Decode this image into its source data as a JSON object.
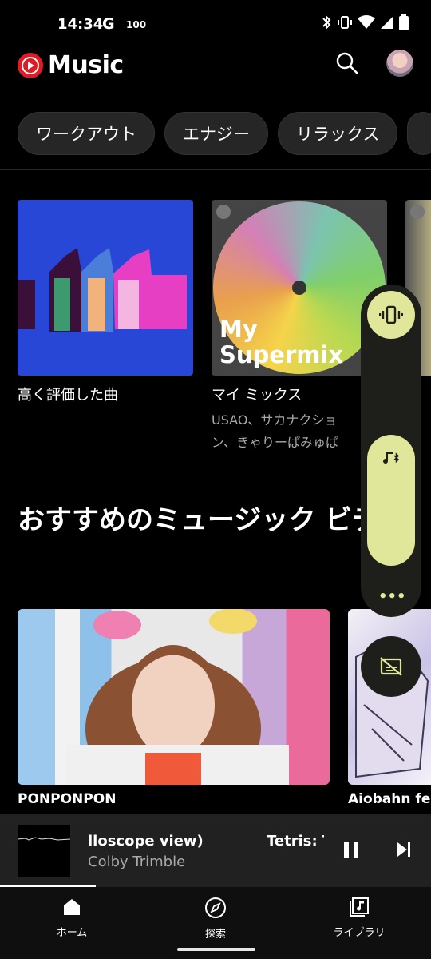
{
  "status_bar": {
    "time": "14:34",
    "google_badge": "G",
    "count": "100",
    "icons": [
      "bluetooth-icon",
      "vibrate-icon",
      "wifi-icon",
      "cell-signal-icon",
      "battery-icon"
    ]
  },
  "app": {
    "name": "Music",
    "brand_color": "#e01b24"
  },
  "chips": [
    "ワークアウト",
    "エナジー",
    "リラックス"
  ],
  "cards": [
    {
      "title": "高く評価した曲",
      "subtitle": ""
    },
    {
      "title": "マイ ミックス",
      "subtitle": "USAO、サカナクション、きゃりーぱみゅぱ",
      "art_text": "My Supermix"
    }
  ],
  "section": {
    "title": "おすすめのミュージック ビデオ"
  },
  "videos": [
    {
      "title": "PONPONPON"
    },
    {
      "title": "Aiobahn feat"
    }
  ],
  "mini_player": {
    "title_scroll": "lloscope view)",
    "next_title": "Tetris: T",
    "artist": "Colby Trimble"
  },
  "nav": [
    {
      "label": "ホーム",
      "icon": "home-icon",
      "active": true
    },
    {
      "label": "探索",
      "icon": "compass-icon",
      "active": false
    },
    {
      "label": "ライブラリ",
      "icon": "library-icon",
      "active": false
    }
  ],
  "volume_panel": {
    "accent": "#e1e79a",
    "more_label": "•••"
  }
}
